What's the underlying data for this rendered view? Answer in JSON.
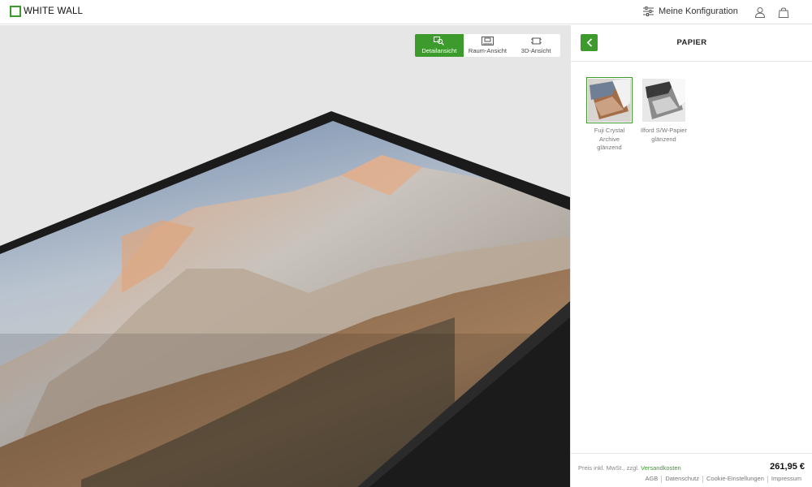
{
  "brand": {
    "name": "WHITE WALL",
    "accent": "#3d9a2c"
  },
  "header": {
    "config_label": "Meine Konfiguration",
    "icons": [
      "sliders-icon",
      "user-icon",
      "shopping-bag-icon"
    ]
  },
  "view_switch": [
    {
      "label": "Detailansicht",
      "icon": "zoom-detail-icon",
      "active": true
    },
    {
      "label": "Raum-Ansicht",
      "icon": "room-view-icon",
      "active": false
    },
    {
      "label": "3D-Ansicht",
      "icon": "cube-3d-icon",
      "active": false
    }
  ],
  "panel": {
    "title": "PAPIER",
    "options": [
      {
        "label": "Fuji Crystal Archive glänzend",
        "selected": true
      },
      {
        "label": "Ilford S/W-Papier glänzend",
        "selected": false
      }
    ]
  },
  "footer": {
    "price_note_prefix": "Preis inkl. MwSt., zzgl.",
    "shipping_link": "Versandkosten",
    "price": "261,95 €",
    "links": [
      "AGB",
      "Datenschutz",
      "Cookie-Einstellungen",
      "Impressum"
    ]
  }
}
